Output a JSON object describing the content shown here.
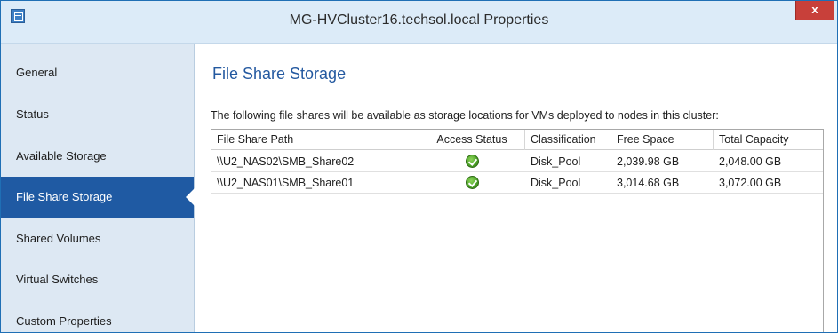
{
  "window": {
    "title": "MG-HVCluster16.techsol.local Properties",
    "close_label": "x"
  },
  "sidebar": {
    "items": [
      {
        "label": "General"
      },
      {
        "label": "Status"
      },
      {
        "label": "Available Storage"
      },
      {
        "label": "File Share Storage",
        "active": true
      },
      {
        "label": "Shared Volumes"
      },
      {
        "label": "Virtual Switches"
      },
      {
        "label": "Custom Properties"
      }
    ]
  },
  "main": {
    "title": "File Share Storage",
    "description": "The following file shares will be available as storage locations for VMs deployed to nodes in this cluster:",
    "table": {
      "columns": [
        "File Share Path",
        "Access Status",
        "Classification",
        "Free Space",
        "Total Capacity"
      ],
      "rows": [
        {
          "path": "\\\\U2_NAS02\\SMB_Share02",
          "access_status_icon": "ok-icon",
          "classification": "Disk_Pool",
          "free_space": "2,039.98 GB",
          "total_capacity": "2,048.00 GB"
        },
        {
          "path": "\\\\U2_NAS01\\SMB_Share01",
          "access_status_icon": "ok-icon",
          "classification": "Disk_Pool",
          "free_space": "3,014.68 GB",
          "total_capacity": "3,072.00 GB"
        }
      ]
    }
  },
  "colors": {
    "accent": "#1f5aa3",
    "title_text": "#2459a0",
    "sidebar_bg": "#dde8f3",
    "titlebar_bg": "#dcebf8",
    "close_button": "#c8403a"
  }
}
